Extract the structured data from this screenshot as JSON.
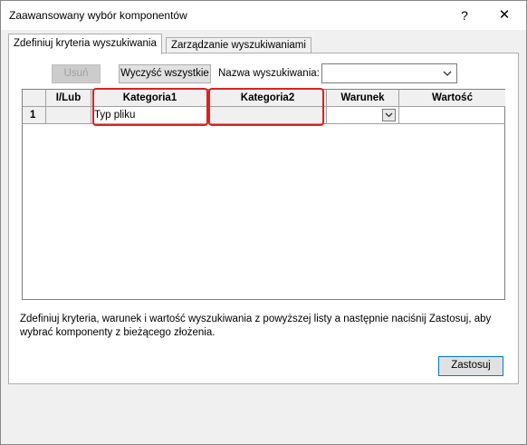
{
  "window": {
    "title": "Zaawansowany wybór komponentów",
    "help_label": "?",
    "close_label": "✕"
  },
  "tabs": [
    {
      "label": "Zdefiniuj kryteria wyszukiwania",
      "active": true
    },
    {
      "label": "Zarządzanie wyszukiwaniami",
      "active": false
    }
  ],
  "toolbar": {
    "delete_label": "Usuń",
    "clear_all_label": "Wyczyść wszystkie",
    "search_name_label": "Nazwa wyszukiwania:",
    "search_name_value": ""
  },
  "grid": {
    "columns": [
      "",
      "I/Lub",
      "Kategoria1",
      "Kategoria2",
      "Warunek",
      "Wartość"
    ],
    "rows": [
      {
        "num": "1",
        "andor": "",
        "cat1": "Typ pliku",
        "cat2": "",
        "condition": "",
        "value": ""
      }
    ]
  },
  "instructions": "Zdefiniuj kryteria, warunek i wartość wyszukiwania z powyższej listy a następnie naciśnij Zastosuj, aby wybrać komponenty z bieżącego złożenia.",
  "apply_label": "Zastosuj",
  "colors": {
    "highlight": "#e02020",
    "accent": "#0078d7"
  }
}
